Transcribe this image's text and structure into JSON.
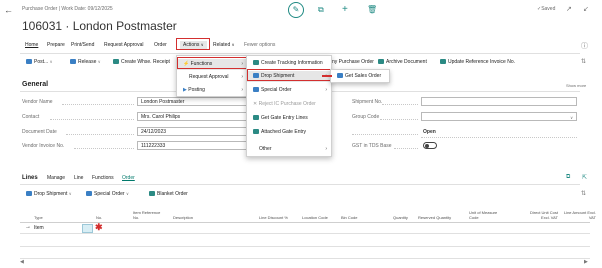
{
  "header": {
    "breadcrumb": "Purchase Order | Work Date: 09/12/2025",
    "title": "106031 · London Postmaster",
    "saved_label": "✓Saved"
  },
  "nav_tabs": [
    "Home",
    "Prepare",
    "Print/Send",
    "Request Approval",
    "Order",
    "Actions",
    "Related",
    "Fewer options"
  ],
  "toolbar": {
    "post": "Post...",
    "release": "Release",
    "create_whse": "Create Whse. Receipt",
    "purchase_order": "ny Purchase Order",
    "archive": "Archive Document",
    "update_ref": "Update Reference Invoice No."
  },
  "general": {
    "title": "General",
    "show_more": "Show more",
    "fields": [
      {
        "label": "Vendor Name",
        "value": "London Postmaster"
      },
      {
        "label": "Contact",
        "value": "Mrs. Carol Philips"
      },
      {
        "label": "Document Date",
        "value": "24/12/2023"
      },
      {
        "label": "Vendor Invoice No.",
        "value": "111222333"
      }
    ],
    "right_fields": [
      {
        "label": "Shipment No.",
        "value": ""
      },
      {
        "label": "Group Code",
        "value": ""
      },
      {
        "label": "",
        "value": "Open"
      },
      {
        "label": "GST in TDS Base",
        "value": ""
      }
    ]
  },
  "actions_menu": {
    "items": [
      "Functions",
      "Request Approval",
      "Posting"
    ]
  },
  "functions_menu": {
    "items": [
      "Create Tracking Information",
      "Drop Shipment",
      "Special Order",
      "Reject IC Purchase Order",
      "Get Gate Entry Lines",
      "Attached Gate Entry",
      "Other"
    ]
  },
  "drop_shipment_menu": {
    "items": [
      "Get Sales Order"
    ]
  },
  "lines": {
    "tabs": [
      "Lines",
      "Manage",
      "Line",
      "Functions",
      "Order"
    ],
    "toolbar": [
      "Drop Shipment",
      "Special Order",
      "Blanket Order"
    ],
    "columns": [
      "Type",
      "No.",
      "Item Reference No.",
      "Description",
      "Line Discount %",
      "Location Code",
      "Bin Code",
      "Quantity",
      "Reserved Quantity",
      "Unit of Measure Code",
      "Direct Unit Cost Excl. VAT",
      "Line Amount Excl. VAT"
    ],
    "row_type": "Item",
    "row_marker": "→"
  },
  "colors": {
    "accent": "#00796b",
    "highlight": "#d32f2f"
  }
}
